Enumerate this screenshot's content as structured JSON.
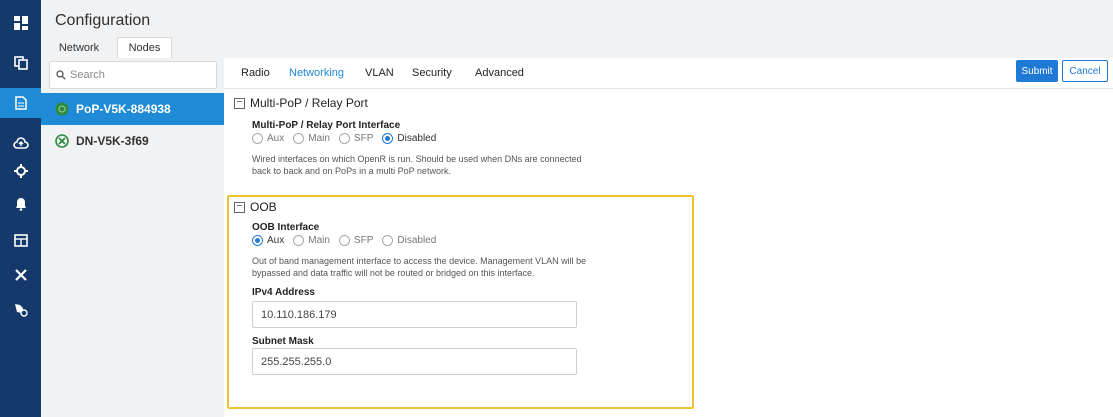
{
  "header": {
    "title": "Configuration",
    "tabs": [
      {
        "label": "Network",
        "active": false
      },
      {
        "label": "Nodes",
        "active": true
      }
    ]
  },
  "rail": {
    "icons": [
      "dashboard-icon",
      "copy-icon",
      "document-icon",
      "cloud-upload-icon",
      "crosshair-icon",
      "bell-icon",
      "table-icon",
      "tools-icon",
      "settings-badge-icon"
    ],
    "active": "document-icon",
    "background": "#15396b",
    "active_color": "#1f8ad6"
  },
  "nodes": {
    "search_placeholder": "Search",
    "items": [
      {
        "name": "PoP-V5K-884938",
        "selected": true
      },
      {
        "name": "DN-V5K-3f69",
        "selected": false
      }
    ]
  },
  "main": {
    "tabs": [
      "Radio",
      "Networking",
      "VLAN",
      "Security",
      "Advanced"
    ],
    "active_tab": "Networking",
    "submit_label": "Submit",
    "cancel_label": "Cancel",
    "multipop": {
      "title": "Multi-PoP / Relay Port",
      "field_label": "Multi-PoP / Relay Port Interface",
      "options": [
        "Aux",
        "Main",
        "SFP",
        "Disabled"
      ],
      "selected": "Disabled",
      "desc_line1": "Wired interfaces on which OpenR is run. Should be used when DNs are connected",
      "desc_line2": "back to back and on PoPs in a multi PoP network."
    },
    "oob": {
      "title": "OOB",
      "field_label": "OOB Interface",
      "options": [
        "Aux",
        "Main",
        "SFP",
        "Disabled"
      ],
      "selected": "Aux",
      "desc_line1": "Out of band management interface to access the device. Management VLAN will be",
      "desc_line2": "bypassed and data traffic will not be routed or bridged on this interface.",
      "ipv4_label": "IPv4 Address",
      "ipv4_value": "10.110.186.179",
      "subnet_label": "Subnet Mask",
      "subnet_value": "255.255.255.0"
    }
  },
  "colors": {
    "accent": "#1f8ad6",
    "highlight": "#f2c230"
  }
}
